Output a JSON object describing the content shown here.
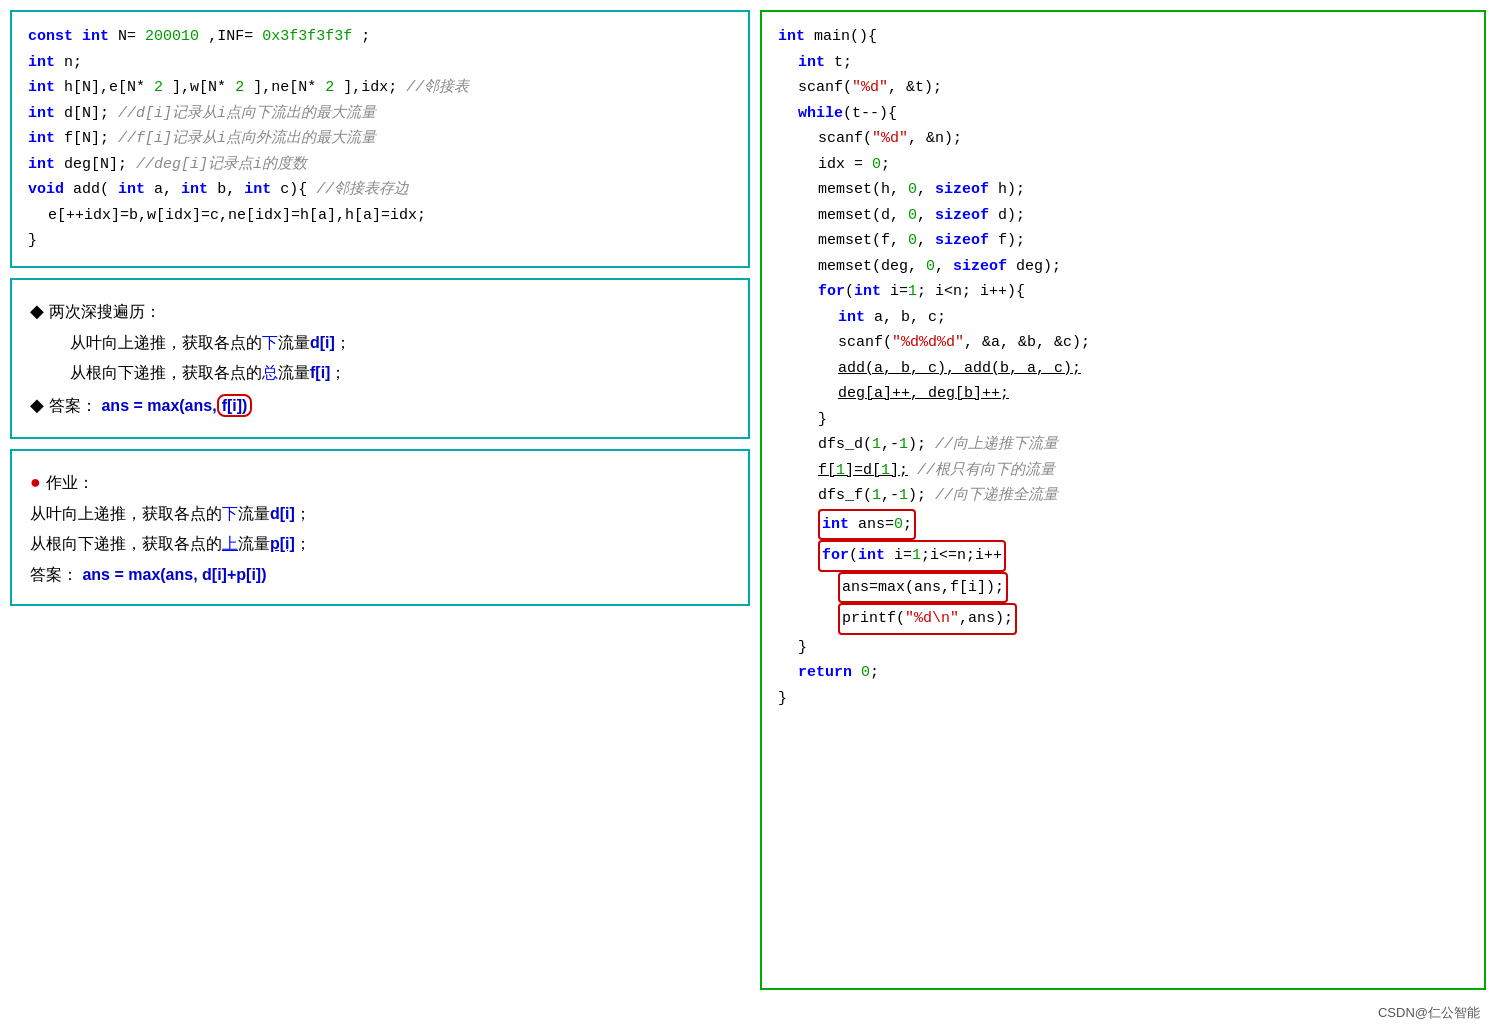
{
  "left": {
    "code_block": {
      "lines": [
        "const int N=200010,INF=0x3f3f3f3f;",
        "int n;",
        "int h[N],e[N*2],w[N*2],ne[N*2],idx;//邻接表",
        "int d[N]; //d[i]记录从i点向下流出的最大流量",
        "int f[N]; //f[i]记录从i点向外流出的最大流量",
        "int deg[N]; //deg[i]记录点i的度数",
        "void add(int a, int b, int c){ //邻接表存边",
        "  e[++idx]=b,w[idx]=c,ne[idx]=h[a],h[a]=idx;",
        "}"
      ]
    },
    "explanation": {
      "title": "两次深搜遍历：",
      "lines": [
        "从叶向上递推，获取各点的下流量d[i]；",
        "从根向下递推，获取各点的总流量f[i]；",
        "答案：ans = max(ans, f[i])"
      ]
    },
    "homework": {
      "title": "作业：",
      "lines": [
        "从叶向上递推，获取各点的下流量d[i]；",
        "从根向下递推，获取各点的上流量p[i]；",
        "答案：ans = max(ans, d[i]+p[i])"
      ]
    }
  },
  "right": {
    "lines": [
      "int main(){",
      "  int t;",
      "  scanf(\"%d\", &t);",
      "  while(t--){",
      "    scanf(\"%d\", &n);",
      "    idx = 0;",
      "    memset(h, 0, sizeof h);",
      "    memset(d, 0, sizeof d);",
      "    memset(f, 0, sizeof f);",
      "    memset(deg, 0, sizeof deg);",
      "    for(int i=1; i<n; i++){",
      "      int a, b, c;",
      "      scanf(\"%d%d%d\", &a, &b, &c);",
      "      add(a, b, c), add(b, a, c);",
      "      deg[a]++, deg[b]++;",
      "    }",
      "    dfs_d(1,-1); //向上递推下流量",
      "    f[1]=d[1]; //根只有向下的流量",
      "    dfs_f(1,-1); //向下递推全流量",
      "    int ans=0;",
      "    for(int i=1;i<=n;i++)",
      "      ans=max(ans,f[i]);",
      "    printf(\"%d\\n\",ans);",
      "  }",
      "  return 0;",
      "}"
    ]
  },
  "footer": {
    "text": "CSDN@仁公智能"
  }
}
